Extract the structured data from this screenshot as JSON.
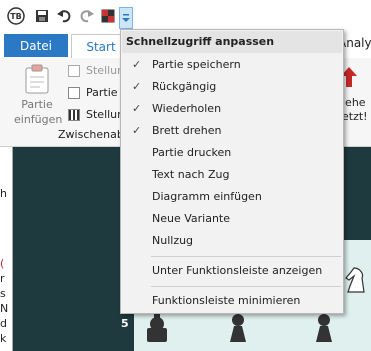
{
  "quick_access": {
    "items": [
      "app-logo-icon",
      "save-icon",
      "undo-icon",
      "redo-icon",
      "flip-board-icon",
      "customize-dropdown-icon"
    ]
  },
  "ribbon": {
    "tab_file": "Datei",
    "tab_start": "Start",
    "tab_analysis_partial": "Analys",
    "paste_label_line1": "Partie",
    "paste_label_line2": "einfügen",
    "rows": [
      "Stellur",
      "Partie",
      "Stellur"
    ],
    "group_label": "Zwischenabl",
    "right_label_line1": "iehe",
    "right_label_line2": "etzt!"
  },
  "left_panel": {
    "texts": [
      "h",
      "(",
      "r",
      "s",
      "N",
      "d",
      "k",
      "n"
    ]
  },
  "board": {
    "rank_label": "5"
  },
  "menu": {
    "title": "Schnellzugriff anpassen",
    "items": [
      {
        "label": "Partie speichern",
        "checked": true
      },
      {
        "label": "Rückgängig",
        "checked": true
      },
      {
        "label": "Wiederholen",
        "checked": true
      },
      {
        "label": "Brett drehen",
        "checked": true
      },
      {
        "label": "Partie drucken",
        "checked": false
      },
      {
        "label": "Text nach Zug",
        "checked": false
      },
      {
        "label": "Diagramm einfügen",
        "checked": false
      },
      {
        "label": "Neue Variante",
        "checked": false
      },
      {
        "label": "Nullzug",
        "checked": false
      }
    ],
    "show_below": "Unter Funktionsleiste anzeigen",
    "minimize": "Funktionsleiste minimieren",
    "check_glyph": "✓"
  }
}
